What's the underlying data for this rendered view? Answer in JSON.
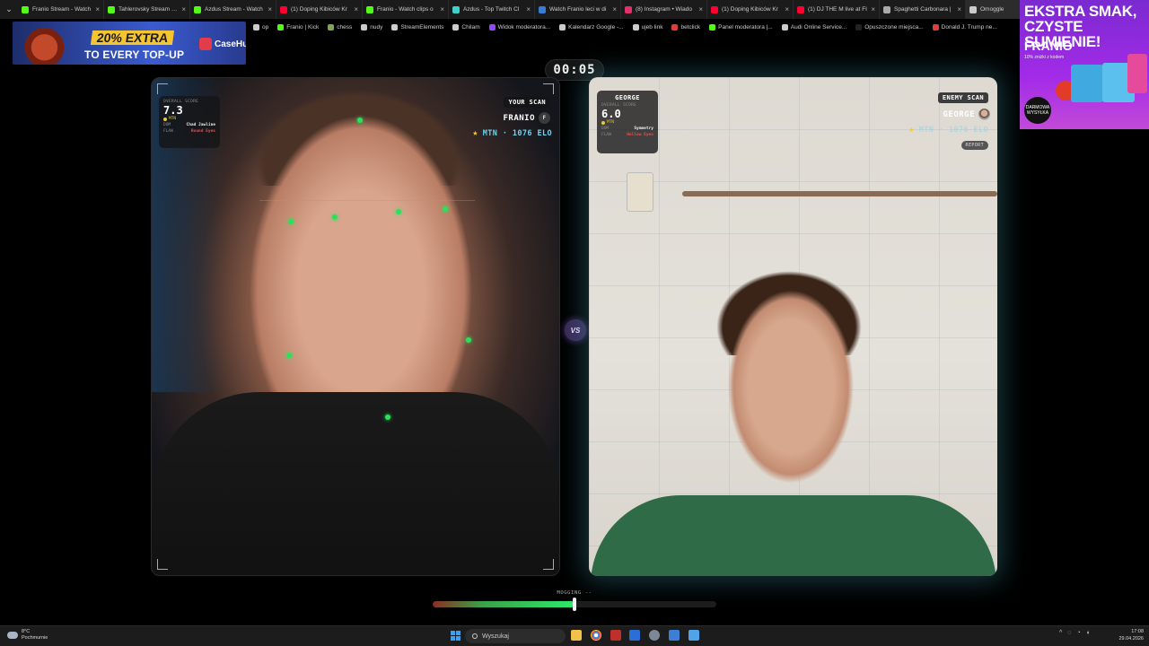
{
  "browser": {
    "tabs": [
      {
        "title": "Franio Stream - Watch",
        "color": "#53fc18"
      },
      {
        "title": "Tahlerovsky Stream - W",
        "color": "#53fc18"
      },
      {
        "title": "Azdus Stream - Watch",
        "color": "#53fc18"
      },
      {
        "title": "(1) Doping Kibiców Kr",
        "color": "#ff0033"
      },
      {
        "title": "Franio - Watch clips o",
        "color": "#53fc18"
      },
      {
        "title": "Azdus - Top Twitch Cl",
        "color": "#3dd1c9"
      },
      {
        "title": "Watch Franio leci w di",
        "color": "#3a7bd5"
      },
      {
        "title": "(8) Instagram • Wiado",
        "color": "#e1306c"
      },
      {
        "title": "(1) Doping Kibiców Kr",
        "color": "#ff0033"
      },
      {
        "title": "(1) DJ THE M live at FI",
        "color": "#ff0033"
      },
      {
        "title": "Spaghetti Carbonara |",
        "color": "#aaaaaa"
      },
      {
        "title": "Omoggle",
        "color": "#cccccc"
      }
    ],
    "bookmarks": [
      {
        "label": "op",
        "color": "#cccccc"
      },
      {
        "label": "Franio | Kick",
        "color": "#53fc18"
      },
      {
        "label": "chess",
        "color": "#7fa650"
      },
      {
        "label": "nudy",
        "color": "#cccccc"
      },
      {
        "label": "StreamElements",
        "color": "#cccccc"
      },
      {
        "label": "Chilam",
        "color": "#cccccc"
      },
      {
        "label": "Widok moderatora...",
        "color": "#9146ff"
      },
      {
        "label": "Kalendarz Google -...",
        "color": "#cccccc"
      },
      {
        "label": "ujeb link",
        "color": "#cccccc"
      },
      {
        "label": "betclick",
        "color": "#e23b3b"
      },
      {
        "label": "Panel moderatora |...",
        "color": "#53fc18"
      },
      {
        "label": "Audi Online Service...",
        "color": "#cccccc"
      },
      {
        "label": "Opuszczone miejsca...",
        "color": "#222222"
      },
      {
        "label": "Donald J. Trump ne...",
        "color": "#e23b3b"
      }
    ]
  },
  "promo": {
    "headline": "20% EXTRA",
    "subline": "TO EVERY TOP-UP",
    "brand": "CaseHug"
  },
  "ad": {
    "headline": "EKSTRA SMAK, CZYSTE SUMIENIE!",
    "brand": "FRANIO",
    "tagline": "10% zniżki z kodem",
    "badge": "DARMOWA WYSYŁKA"
  },
  "match": {
    "timer": "00:05",
    "vs_label": "VS",
    "left": {
      "scan_label": "YOUR SCAN",
      "player_name": "FRANIO",
      "avatar_letter": "F",
      "elo_text": "MTN · 1076 ELO",
      "card": {
        "title_label": "OVERALL SCORE",
        "score": "7.3",
        "tier": "MTN",
        "row1_key": "DOM",
        "row1_value": "Chad Jawline",
        "row2_key": "FLAW",
        "row2_value": "Round Eyes"
      }
    },
    "right": {
      "scan_label": "ENEMY SCAN",
      "player_name": "GEORGE",
      "elo_text": "MTN · 1076 ELO",
      "report_label": "REPORT",
      "card": {
        "name": "GEORGE",
        "title_label": "OVERALL SCORE",
        "score": "6.0",
        "tier": "MTN",
        "row1_key": "DOM",
        "row1_value": "Symmetry",
        "row2_key": "FLAW",
        "row2_value": "Hollow Eyes"
      }
    },
    "mogging": {
      "label": "MOGGING --",
      "level": 0.5
    }
  },
  "taskbar": {
    "weather_temp": "8°C",
    "weather_desc": "Pochmurnie",
    "search_placeholder": "Wyszukaj",
    "time": "17:08",
    "date": "29.04.2026"
  }
}
